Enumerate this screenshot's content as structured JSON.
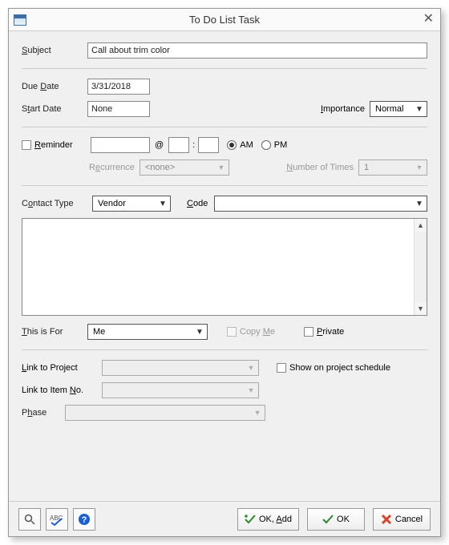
{
  "window": {
    "title": "To Do List Task"
  },
  "subject": {
    "label": "Subject",
    "value": "Call about trim color"
  },
  "dueDate": {
    "label": "Due Date",
    "value": "3/31/2018"
  },
  "startDate": {
    "label": "Start Date",
    "value": "None"
  },
  "importance": {
    "label": "Importance",
    "value": "Normal"
  },
  "reminder": {
    "label": "Reminder",
    "date": "",
    "hour": "",
    "minute": "",
    "am": "AM",
    "pm": "PM",
    "timeSep": "@",
    "colon": ":"
  },
  "recurrence": {
    "label": "Recurrence",
    "value": "<none>"
  },
  "numberOfTimes": {
    "label": "Number of Times",
    "value": "1"
  },
  "contactType": {
    "label": "Contact Type",
    "value": "Vendor"
  },
  "code": {
    "label": "Code",
    "value": ""
  },
  "notes": {
    "value": ""
  },
  "thisIsFor": {
    "label": "This is For",
    "value": "Me"
  },
  "copyMe": {
    "label": "Copy Me"
  },
  "private": {
    "label": "Private"
  },
  "linkProject": {
    "label": "Link to Project",
    "value": ""
  },
  "showProject": {
    "label": "Show on project schedule"
  },
  "linkItem": {
    "label": "Link to Item No.",
    "value": ""
  },
  "phase": {
    "label": "Phase",
    "value": ""
  },
  "buttons": {
    "okAdd": "OK, Add",
    "ok": "OK",
    "cancel": "Cancel"
  }
}
